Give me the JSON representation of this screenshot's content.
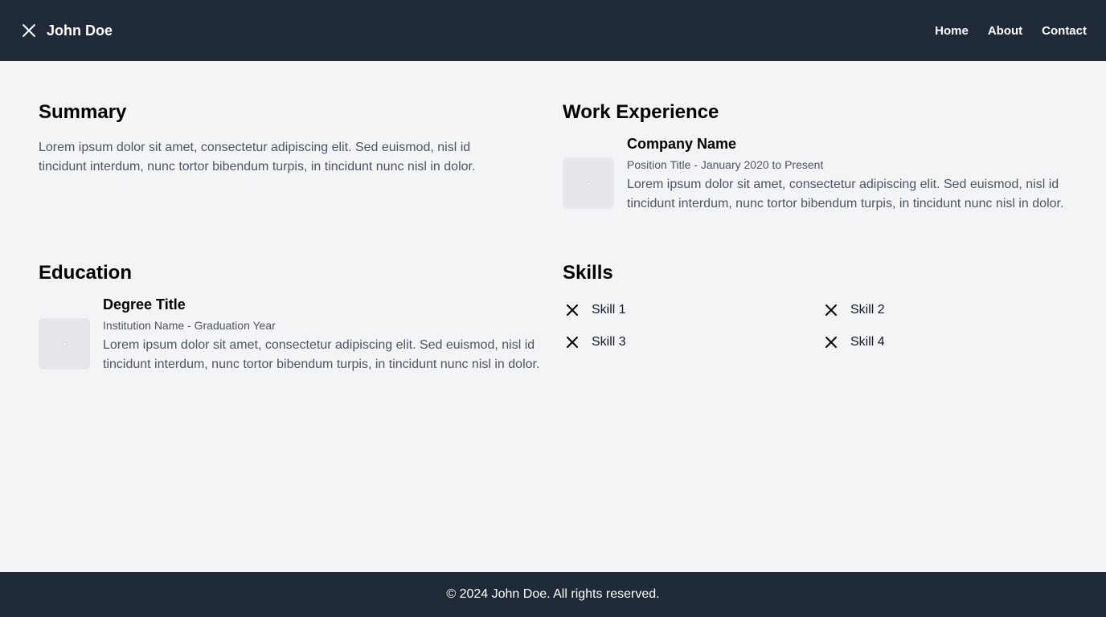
{
  "header": {
    "brand_icon": "close-icon",
    "brand_name": "John Doe",
    "nav": [
      "Home",
      "About",
      "Contact"
    ]
  },
  "summary": {
    "title": "Summary",
    "text": "Lorem ipsum dolor sit amet, consectetur adipiscing elit. Sed euismod, nisl id tincidunt interdum, nunc tortor bibendum turpis, in tincidunt nunc nisl in dolor."
  },
  "work": {
    "title": "Work Experience",
    "company": "Company Name",
    "subtitle": "Position Title - January 2020 to Present",
    "text": "Lorem ipsum dolor sit amet, consectetur adipiscing elit. Sed euismod, nisl id tincidunt interdum, nunc tortor bibendum turpis, in tincidunt nunc nisl in dolor."
  },
  "education": {
    "title": "Education",
    "degree": "Degree Title",
    "subtitle": "Institution Name - Graduation Year",
    "text": "Lorem ipsum dolor sit amet, consectetur adipiscing elit. Sed euismod, nisl id tincidunt interdum, nunc tortor bibendum turpis, in tincidunt nunc nisl in dolor."
  },
  "skills": {
    "title": "Skills",
    "items": [
      "Skill 1",
      "Skill 2",
      "Skill 3",
      "Skill 4"
    ],
    "icon": "close-icon"
  },
  "footer": {
    "text": "© 2024 John Doe. All rights reserved."
  },
  "colors": {
    "header_bg": "#1f2937",
    "page_bg": "#f3f4f6",
    "muted_text": "#4b5563"
  }
}
